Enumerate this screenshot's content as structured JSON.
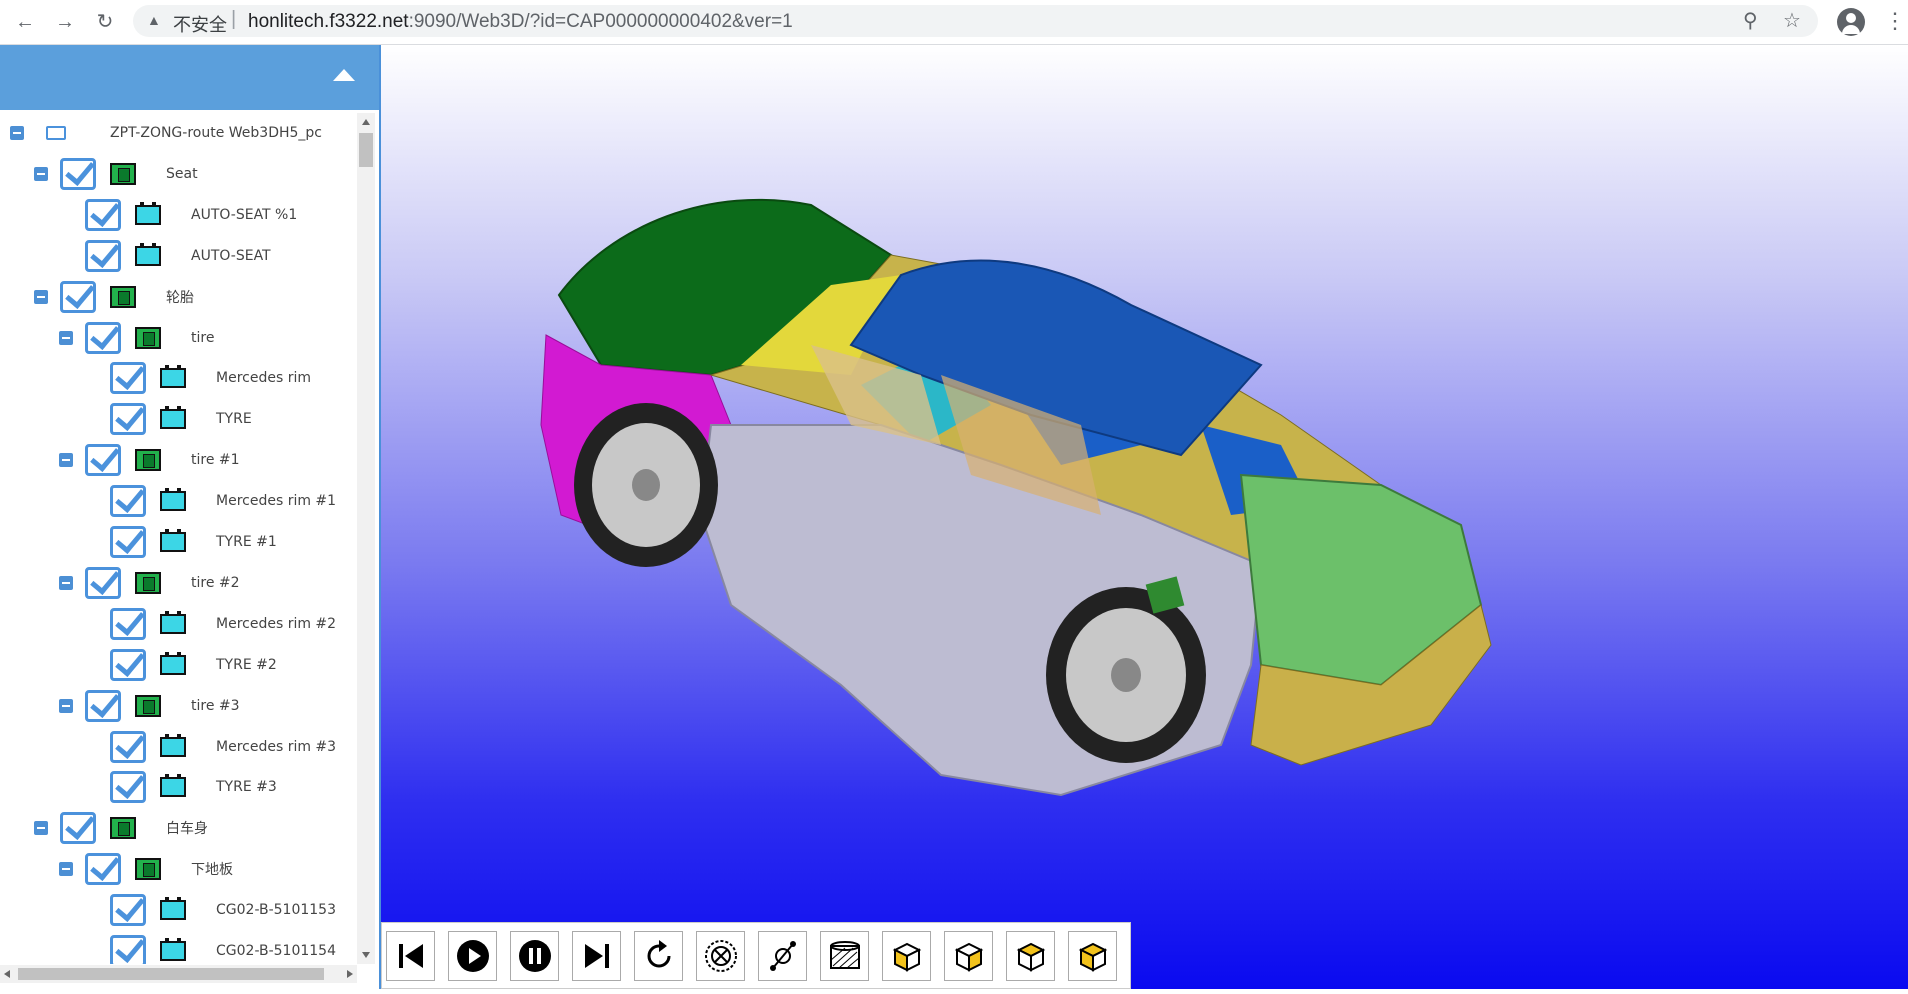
{
  "browser": {
    "security_label": "不安全",
    "url_host": "honlitech.f3322.net",
    "url_rest": ":9090/Web3D/?id=CAP000000000402&ver=1"
  },
  "tree": [
    {
      "label": "ZPT-ZONG-route Web3DH5_pc",
      "type": "root",
      "depth": 0
    },
    {
      "label": "Seat",
      "type": "assembly",
      "depth": 1
    },
    {
      "label": "AUTO-SEAT %1",
      "type": "part",
      "depth": 2
    },
    {
      "label": "AUTO-SEAT",
      "type": "part",
      "depth": 2
    },
    {
      "label": "轮胎",
      "type": "assembly",
      "depth": 1
    },
    {
      "label": "tire",
      "type": "assembly",
      "depth": 2
    },
    {
      "label": "Mercedes rim",
      "type": "part",
      "depth": 3
    },
    {
      "label": "TYRE",
      "type": "part",
      "depth": 3
    },
    {
      "label": "tire #1",
      "type": "assembly",
      "depth": 2
    },
    {
      "label": "Mercedes rim #1",
      "type": "part",
      "depth": 3
    },
    {
      "label": "TYRE #1",
      "type": "part",
      "depth": 3
    },
    {
      "label": "tire #2",
      "type": "assembly",
      "depth": 2
    },
    {
      "label": "Mercedes rim #2",
      "type": "part",
      "depth": 3
    },
    {
      "label": "TYRE #2",
      "type": "part",
      "depth": 3
    },
    {
      "label": "tire #3",
      "type": "assembly",
      "depth": 2
    },
    {
      "label": "Mercedes rim #3",
      "type": "part",
      "depth": 3
    },
    {
      "label": "TYRE #3",
      "type": "part",
      "depth": 3
    },
    {
      "label": "白车身",
      "type": "assembly",
      "depth": 1
    },
    {
      "label": "下地板",
      "type": "assembly",
      "depth": 2
    },
    {
      "label": "CG02-B-5101153",
      "type": "part",
      "depth": 3
    },
    {
      "label": "CG02-B-5101154",
      "type": "part",
      "depth": 3
    }
  ],
  "toolbar": [
    {
      "name": "first-step-button",
      "icon": "skip-back-icon"
    },
    {
      "name": "play-button",
      "icon": "play-icon"
    },
    {
      "name": "pause-button",
      "icon": "pause-icon"
    },
    {
      "name": "last-step-button",
      "icon": "skip-forward-icon"
    },
    {
      "name": "reset-button",
      "icon": "rotate-icon"
    },
    {
      "name": "explode-button",
      "icon": "gear-explode-icon"
    },
    {
      "name": "measure-button",
      "icon": "measure-icon"
    },
    {
      "name": "section-button",
      "icon": "hatch-section-icon"
    },
    {
      "name": "view-front-button",
      "icon": "cube-front-icon"
    },
    {
      "name": "view-side-button",
      "icon": "cube-side-icon"
    },
    {
      "name": "view-top-button",
      "icon": "cube-top-icon"
    },
    {
      "name": "view-iso-button",
      "icon": "cube-iso-icon"
    }
  ],
  "colors": {
    "panel_header": "#5b9fdc",
    "checkbox": "#4b92dc",
    "assembly_icon": "#22b14c",
    "part_icon": "#3cd6e6",
    "viewport_bottom": "#0a0af0"
  }
}
